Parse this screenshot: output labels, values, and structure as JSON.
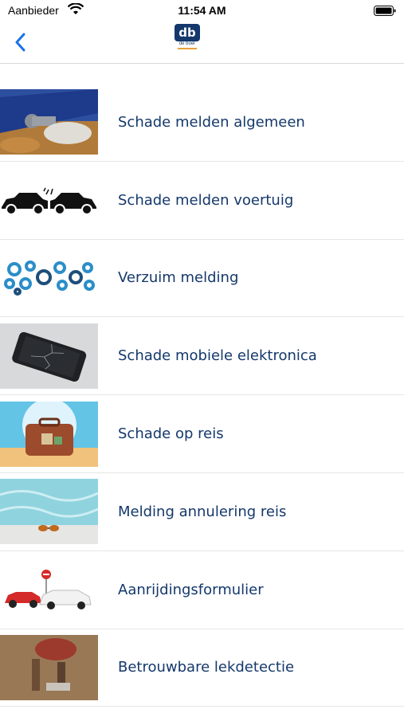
{
  "status_bar": {
    "carrier": "Aanbieder",
    "time": "11:54 AM"
  },
  "header": {
    "logo_mark": "db",
    "logo_text": "de boer"
  },
  "items": [
    {
      "label": "Schade melden algemeen",
      "image": "leaking-pipe"
    },
    {
      "label": "Schade melden voertuig",
      "image": "car-collision"
    },
    {
      "label": "Verzuim melding",
      "image": "gears"
    },
    {
      "label": "Schade mobiele elektronica",
      "image": "broken-phone"
    },
    {
      "label": "Schade op reis",
      "image": "suitcase-beach"
    },
    {
      "label": "Melding annulering reis",
      "image": "pool-sunglasses"
    },
    {
      "label": "Aanrijdingsformulier",
      "image": "car-accident"
    },
    {
      "label": "Betrouwbare lekdetectie",
      "image": "leak-detection"
    }
  ],
  "colors": {
    "accent": "#1a73e8",
    "label": "#14386b"
  }
}
